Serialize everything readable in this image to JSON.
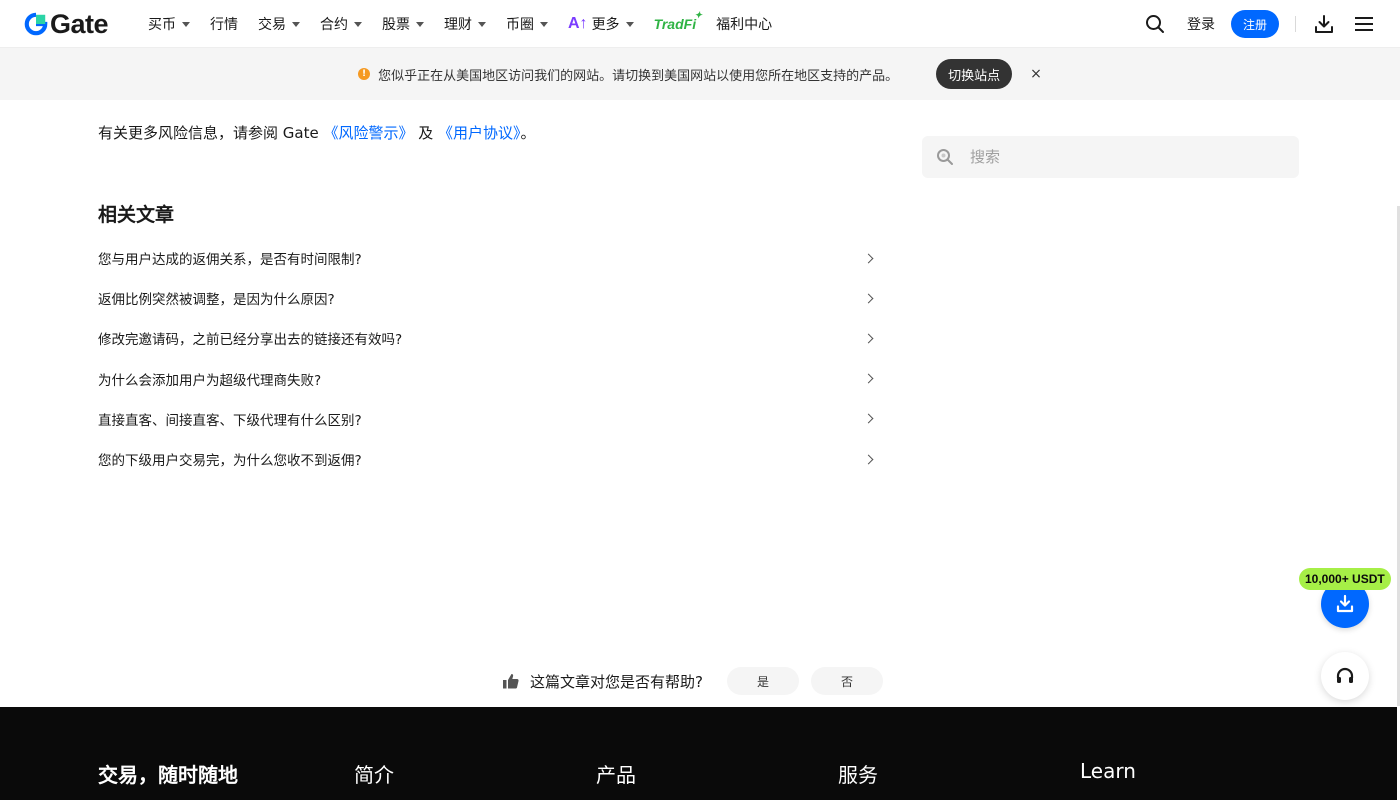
{
  "header": {
    "logo_text": "Gate",
    "nav": [
      {
        "label": "买币",
        "dropdown": true
      },
      {
        "label": "行情",
        "dropdown": false
      },
      {
        "label": "交易",
        "dropdown": true
      },
      {
        "label": "合约",
        "dropdown": true
      },
      {
        "label": "股票",
        "dropdown": true
      },
      {
        "label": "理财",
        "dropdown": true
      },
      {
        "label": "币圈",
        "dropdown": true
      }
    ],
    "more_label": "更多",
    "tradfi_label": "TradFi",
    "welfare_label": "福利中心",
    "login_label": "登录",
    "register_label": "注册",
    "brand_color": "#0068ff"
  },
  "notice": {
    "text": "您似乎正在从美国地区访问我们的网站。请切换到美国网站以使用您所在地区支持的产品。",
    "switch_label": "切换站点",
    "close_label": "×"
  },
  "main": {
    "risk_prefix": "有关更多风险信息，请参阅 Gate ",
    "risk_link1": "《风险警示》",
    "risk_and": " 及 ",
    "risk_link2": "《用户协议》",
    "risk_suffix": "。",
    "search_placeholder": "搜索",
    "related_title": "相关文章",
    "related": [
      "您与用户达成的返佣关系，是否有时间限制?",
      "返佣比例突然被调整，是因为什么原因?",
      "修改完邀请码，之前已经分享出去的链接还有效吗?",
      "为什么会添加用户为超级代理商失败?",
      "直接直客、间接直客、下级代理有什么区别?",
      "您的下级用户交易完，为什么您收不到返佣?"
    ],
    "helpful_question": "这篇文章对您是否有帮助?",
    "yes_label": "是",
    "no_label": "否"
  },
  "floating": {
    "promo": "10,000+ USDT"
  },
  "footer": {
    "columns": [
      "交易，随时随地",
      "简介",
      "产品",
      "服务",
      "Learn"
    ]
  }
}
